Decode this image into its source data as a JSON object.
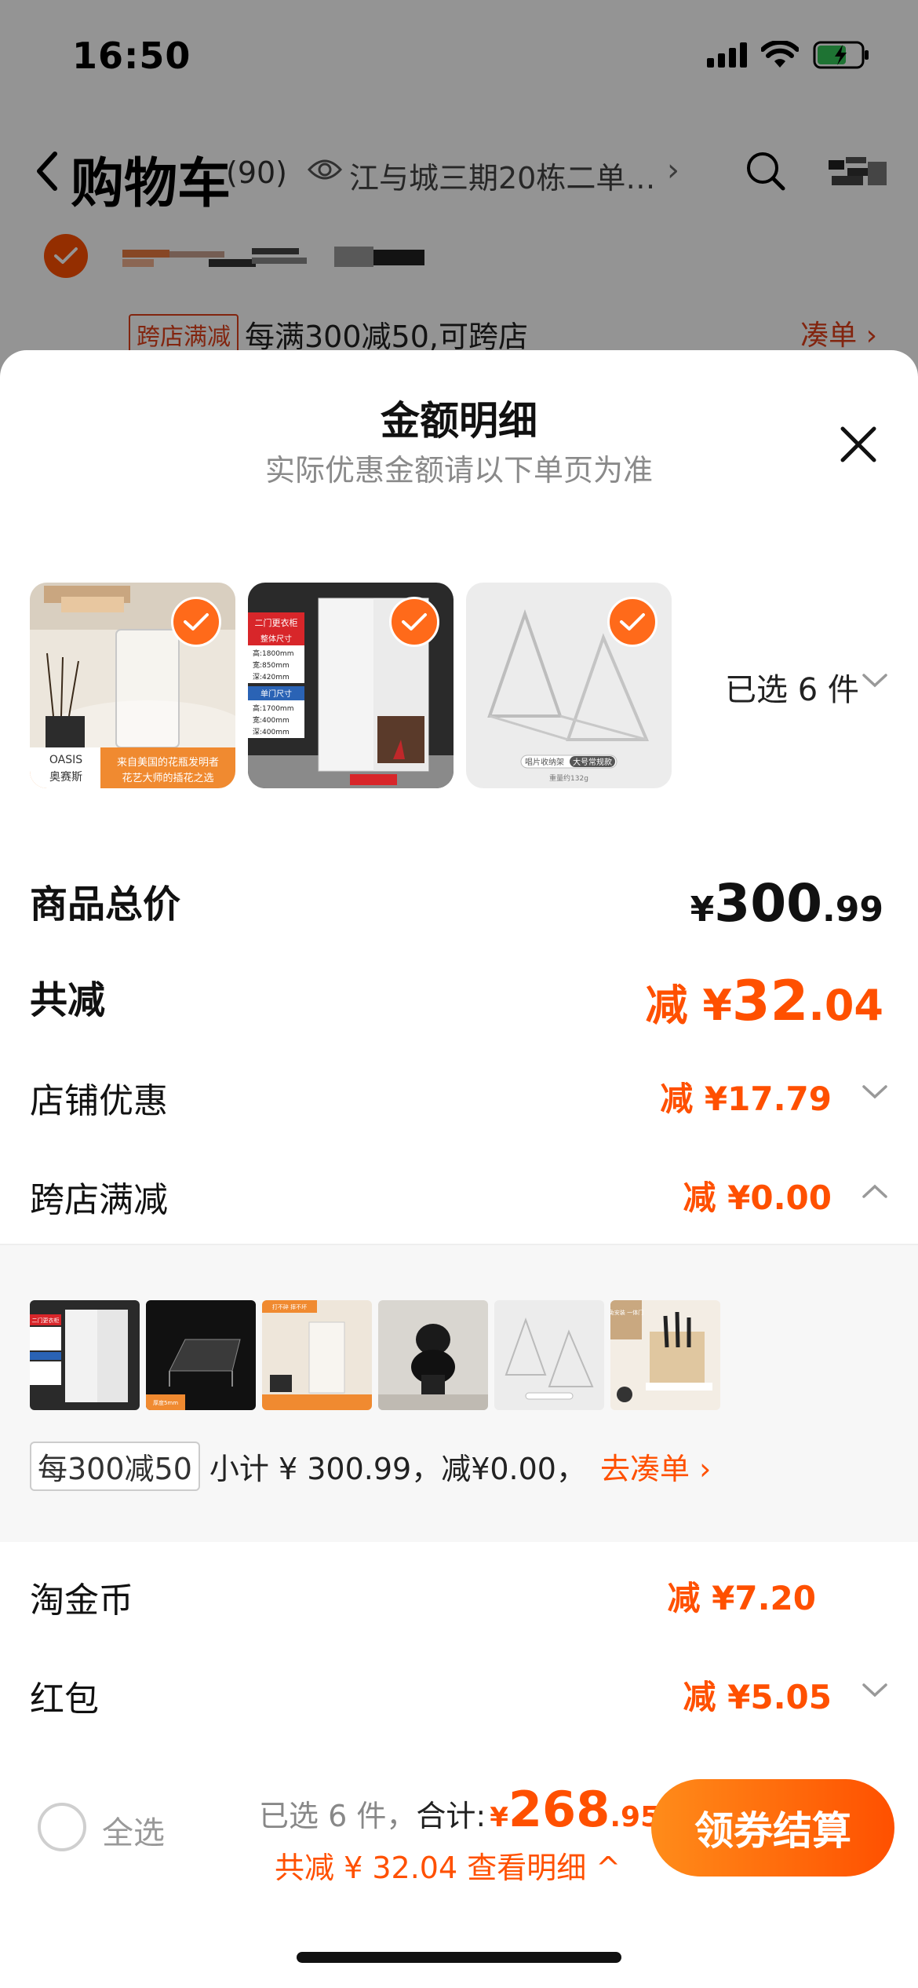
{
  "status_bar": {
    "time": "16:50"
  },
  "background": {
    "title": "购物车",
    "count": "(90)",
    "address": "江与城三期20栋二单…",
    "promo_tag": "跨店满减",
    "promo_text": "每满300减50,可跨店",
    "promo_link": "凑单 ›"
  },
  "sheet": {
    "title": "金额明细",
    "subtitle": "实际优惠金额请以下单页为准",
    "selected_count": "已选 6 件",
    "products": [
      {
        "name": "glass-vase",
        "badge_lines": [
          "来自美国的花瓶发明者",
          "花艺大师的插花之选"
        ],
        "brand": "奥赛斯"
      },
      {
        "name": "white-wardrobe",
        "badge_lines": [
          "二门更衣柜",
          "整体尺寸",
          "高:1800mm",
          "宽:850mm",
          "深:420mm",
          "单门尺寸",
          "高:1700mm",
          "宽:400mm",
          "深:400mm"
        ]
      },
      {
        "name": "record-stand",
        "badge_lines": [
          "唱片收纳架",
          "大号常规款",
          "重量约132g"
        ]
      }
    ],
    "totals": {
      "goods_label": "商品总价",
      "goods_currency": "¥",
      "goods_int": "300",
      "goods_dec": ".99",
      "discount_label": "共减",
      "discount_prefix": "减 ¥",
      "discount_int": "32",
      "discount_dec": ".04"
    },
    "items": [
      {
        "label": "店铺优惠",
        "value": "减 ¥17.79"
      },
      {
        "label": "跨店满减",
        "value": "减 ¥0.00"
      },
      {
        "label": "淘金币",
        "value": "减 ¥7.20"
      },
      {
        "label": "红包",
        "value": "减 ¥5.05"
      }
    ],
    "cross_store": {
      "tag": "每300减50",
      "subtotal": "小计 ¥ 300.99，减¥0.00，",
      "link": "去凑单 ›",
      "thumb_labels": [
        "二门更衣柜",
        "厚度5mm",
        "打不碎 摔不坏",
        "",
        "",
        "免安装 一体门"
      ]
    }
  },
  "bottom_bar": {
    "select_all": "全选",
    "summary_prefix": "已选 6 件，",
    "summary_total_label": "合计:",
    "total_currency": "¥",
    "total_int": "268",
    "total_dec": ".95",
    "detail": "共减 ¥ 32.04  查看明细 ^",
    "checkout": "领券结算"
  },
  "colors": {
    "accent": "#ff5000",
    "accent_light": "#ff8c1a",
    "muted": "#8a8a8a"
  }
}
